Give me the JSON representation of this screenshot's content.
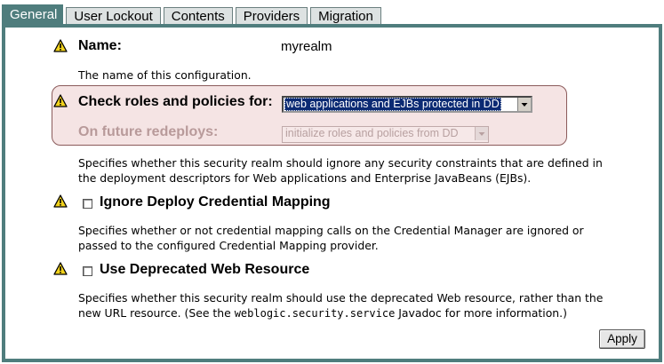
{
  "tabs": [
    {
      "label": "General",
      "active": true
    },
    {
      "label": "User Lockout",
      "active": false
    },
    {
      "label": "Contents",
      "active": false
    },
    {
      "label": "Providers",
      "active": false
    },
    {
      "label": "Migration",
      "active": false
    }
  ],
  "name_field": {
    "label": "Name:",
    "value": "myrealm",
    "description": "The name of this configuration."
  },
  "check_roles": {
    "label": "Check roles and policies for:",
    "selected": "web applications and EJBs protected in DD",
    "future_label": "On future redeploys:",
    "future_selected": "initialize roles and policies from DD",
    "description_line1": "Specifies whether this security realm should ignore any security constraints that are defined in",
    "description_line2": "the deployment descriptors for Web applications and Enterprise JavaBeans (EJBs)."
  },
  "ignore_deploy": {
    "label": "Ignore Deploy Credential Mapping",
    "checked": false,
    "description_line1": "Specifies whether or not credential mapping calls on the Credential Manager are ignored or",
    "description_line2": "passed to the configured Credential Mapping provider."
  },
  "deprecated_web": {
    "label": "Use Deprecated Web Resource",
    "checked": false,
    "description_line1": "Specifies whether this security realm should use the deprecated Web resource, rather than the",
    "description_line2_pre": "new URL resource. (See the ",
    "description_line2_code": "weblogic.security.service",
    "description_line2_post": " Javadoc for more information.)"
  },
  "apply_label": "Apply",
  "colors": {
    "tab_active": "#4f7d7d",
    "highlight_bg": "#f5e4e4",
    "select_highlight": "#0b2a73",
    "warning": "#f2d21b"
  },
  "icons": {
    "warning": "warning-triangle-icon",
    "dropdown": "chevron-down-icon"
  }
}
